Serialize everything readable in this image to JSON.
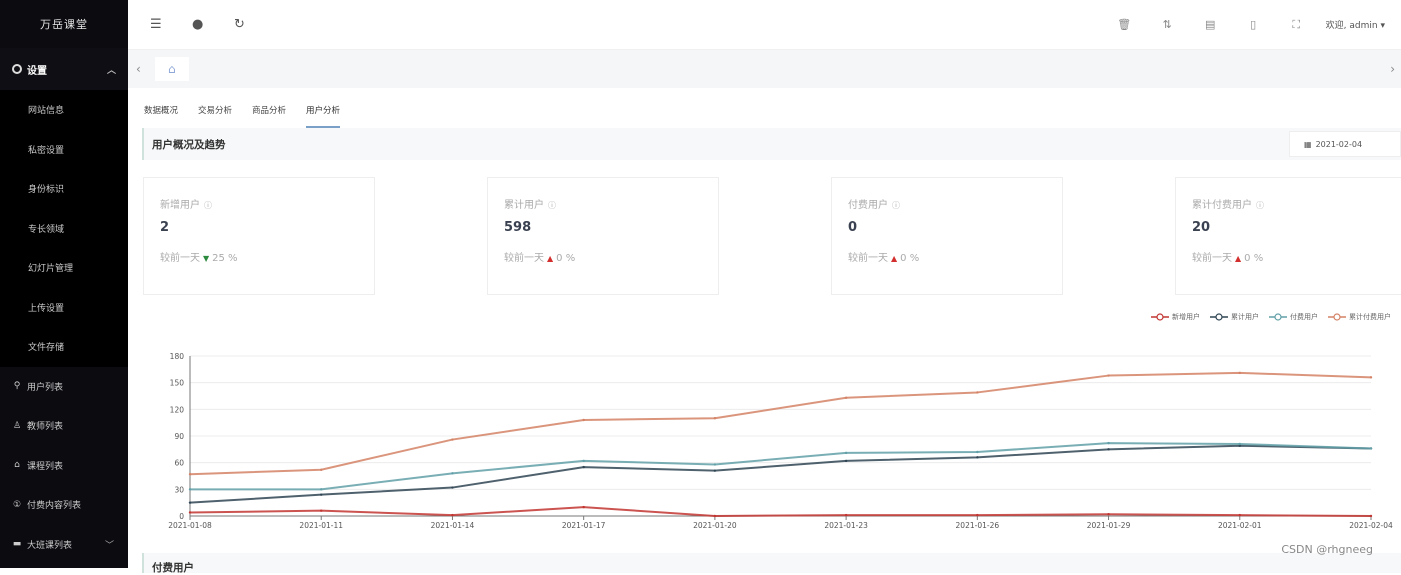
{
  "sidebar": {
    "logo": "万岳课堂",
    "parent": {
      "label": "设置",
      "icon": "gear-icon",
      "expanded": true
    },
    "sub_items": [
      "网站信息",
      "私密设置",
      "身份标识",
      "专长领域",
      "幻灯片管理",
      "上传设置",
      "文件存储"
    ],
    "items": [
      {
        "label": "用户列表",
        "icon": "user-icon"
      },
      {
        "label": "教师列表",
        "icon": "teacher-icon"
      },
      {
        "label": "课程列表",
        "icon": "course-icon"
      },
      {
        "label": "付费内容列表",
        "icon": "paid-icon"
      },
      {
        "label": "大班课列表",
        "icon": "class-icon",
        "has_children": true
      }
    ]
  },
  "topbar": {
    "left_icons": [
      "menu-fold-icon",
      "globe-icon",
      "refresh-icon"
    ],
    "right_icons": [
      "trash-icon",
      "switch-icon",
      "book-icon",
      "file-icon",
      "fullscreen-icon"
    ],
    "user_label": "欢迎, admin"
  },
  "tabs": {
    "items": [
      "数据概况",
      "交易分析",
      "商品分析",
      "用户分析"
    ],
    "active": 3
  },
  "section": {
    "title": "用户概况及趋势",
    "date": "2021-02-04"
  },
  "cards": [
    {
      "label": "新增用户",
      "value": "2",
      "compare_label": "较前一天",
      "direction": "down",
      "change": "25 %"
    },
    {
      "label": "累计用户",
      "value": "598",
      "compare_label": "较前一天",
      "direction": "up",
      "change": "0 %"
    },
    {
      "label": "付费用户",
      "value": "0",
      "compare_label": "较前一天",
      "direction": "up",
      "change": "0 %"
    },
    {
      "label": "累计付费用户",
      "value": "20",
      "compare_label": "较前一天",
      "direction": "up",
      "change": "0 %"
    }
  ],
  "chart_data": {
    "type": "line",
    "title": "",
    "xlabel": "",
    "ylabel": "",
    "x": [
      "2021-01-08",
      "2021-01-11",
      "2021-01-14",
      "2021-01-17",
      "2021-01-20",
      "2021-01-23",
      "2021-01-26",
      "2021-01-29",
      "2021-02-01",
      "2021-02-04"
    ],
    "ylim": [
      0,
      180
    ],
    "yticks": [
      0,
      30,
      60,
      90,
      120,
      150,
      180
    ],
    "grid": true,
    "legend_position": "top-right",
    "series": [
      {
        "name": "新增用户",
        "color": "#c23531",
        "values": [
          4,
          6,
          1,
          10,
          0,
          1,
          1,
          2,
          1,
          0
        ]
      },
      {
        "name": "累计用户",
        "color": "#2f4554",
        "values": [
          15,
          24,
          32,
          55,
          51,
          62,
          66,
          75,
          79,
          76
        ]
      },
      {
        "name": "付费用户",
        "color": "#61a0a8",
        "values": [
          30,
          30,
          48,
          62,
          58,
          71,
          72,
          82,
          81,
          76
        ]
      },
      {
        "name": "累计付费用户",
        "color": "#d48265",
        "values": [
          47,
          52,
          86,
          108,
          110,
          133,
          139,
          158,
          161,
          156
        ]
      }
    ]
  },
  "bottom_section": {
    "title": "付费用户"
  },
  "watermark": "CSDN @rhgneeg"
}
